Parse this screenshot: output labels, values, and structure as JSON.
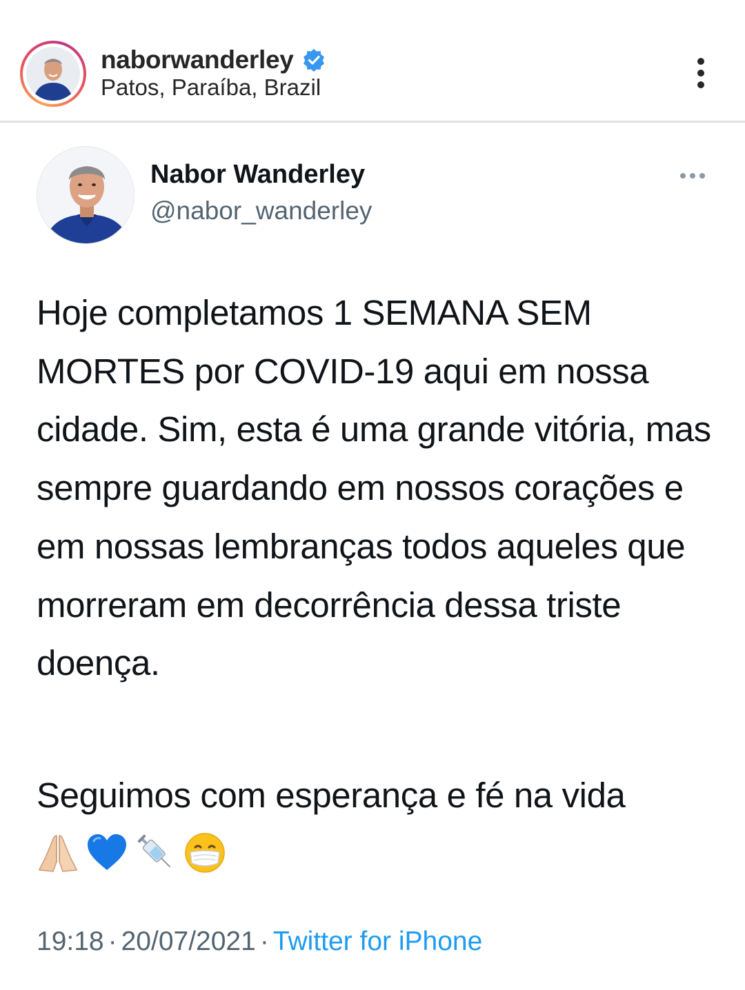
{
  "instagram_header": {
    "username": "naborwanderley",
    "location": "Patos, Paraíba, Brazil",
    "verified_icon": "verified-badge-icon",
    "more_icon": "more-vertical-icon"
  },
  "tweet": {
    "display_name": "Nabor Wanderley",
    "handle": "@nabor_wanderley",
    "more_icon": "more-horizontal-icon",
    "text_paragraph_1": "Hoje completamos 1 SEMANA SEM MORTES por COVID-19 aqui em nossa cidade. Sim, esta é uma grande vitória, mas sempre guardando em nossos corações e em nossas lembranças  todos aqueles que morreram em decorrência dessa triste doença.",
    "text_paragraph_2": "Seguimos com esperança e fé na vida",
    "emojis": [
      "folded-hands-emoji",
      "blue-heart-emoji",
      "syringe-emoji",
      "face-with-medical-mask-emoji"
    ],
    "time": "19:18",
    "date": "20/07/2021",
    "separator": "·",
    "source": "Twitter for iPhone"
  },
  "colors": {
    "verified_blue": "#3897f0",
    "link_blue": "#1d9bf0",
    "secondary_text": "#536471",
    "primary_text": "#0f1419"
  }
}
